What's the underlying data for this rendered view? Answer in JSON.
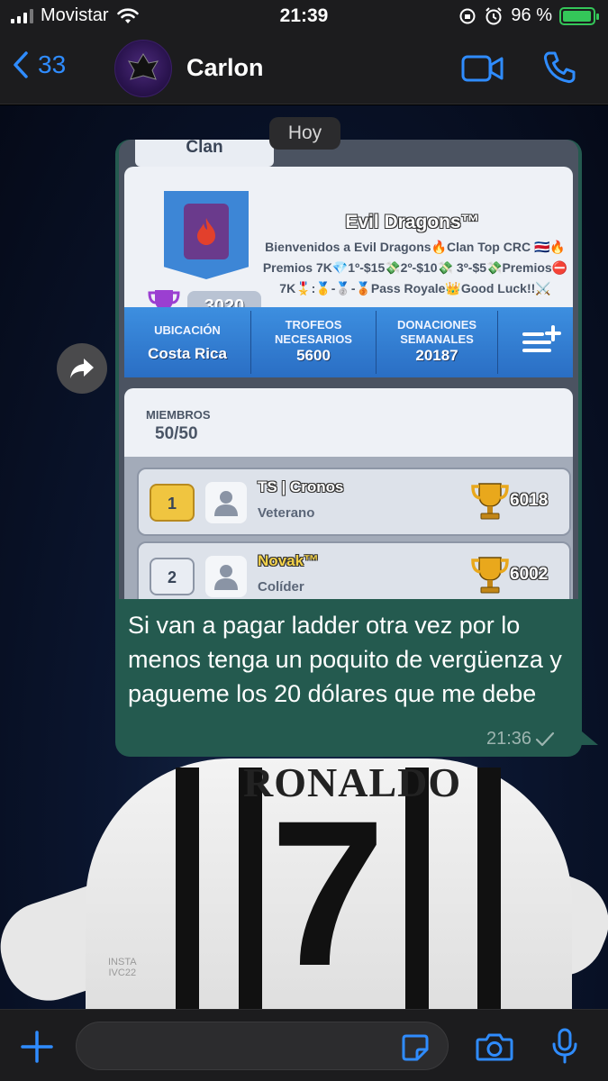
{
  "status_bar": {
    "carrier": "Movistar",
    "time": "21:39",
    "battery_percent": "96 %",
    "battery_level": 0.96
  },
  "header": {
    "back_count": "33",
    "contact_name": "Carlon",
    "avatar_text": "DRAGONS"
  },
  "chat": {
    "date_label": "Hoy",
    "message": {
      "text": "Si van a pagar ladder otra vez por lo menos tenga un poquito de vergüenza y pagueme los 20 dólares que me debe",
      "time": "21:36",
      "status": "sent-check"
    }
  },
  "screenshot": {
    "tab_label": "Clan",
    "clan_name": "Evil Dragons™",
    "clan_description": "Bienvenidos a Evil Dragons🔥Clan Top CRC 🇨🇷🔥Premios 7K💎1º-$15💸2º-$10💸 3º-$5💸Premios⛔7K🎖️:🥇-🥈-🥉Pass Royale👑Good Luck!!⚔️",
    "clan_trophies": "3020",
    "stats": {
      "location_label": "UBICACIÓN",
      "location_value": "Costa Rica",
      "required_label_1": "TROFEOS",
      "required_label_2": "NECESARIOS",
      "required_value": "5600",
      "donations_label_1": "DONACIONES",
      "donations_label_2": "SEMANALES",
      "donations_value": "20187"
    },
    "members_label": "MIEMBROS",
    "members_value": "50/50",
    "members": [
      {
        "rank": "1",
        "name": "TS | Cronos",
        "role": "Veterano",
        "trophies": "6018"
      },
      {
        "rank": "2",
        "name": "Novak™",
        "role": "Colíder",
        "trophies": "6002"
      }
    ]
  },
  "wallpaper": {
    "jersey_name": "RONALDO",
    "jersey_number": "7",
    "watermark_1": "INSTA",
    "watermark_2": "IVC22"
  },
  "input": {
    "placeholder": ""
  },
  "colors": {
    "accent": "#2f8cff",
    "bubble": "#245a4f",
    "battery": "#34c759"
  }
}
